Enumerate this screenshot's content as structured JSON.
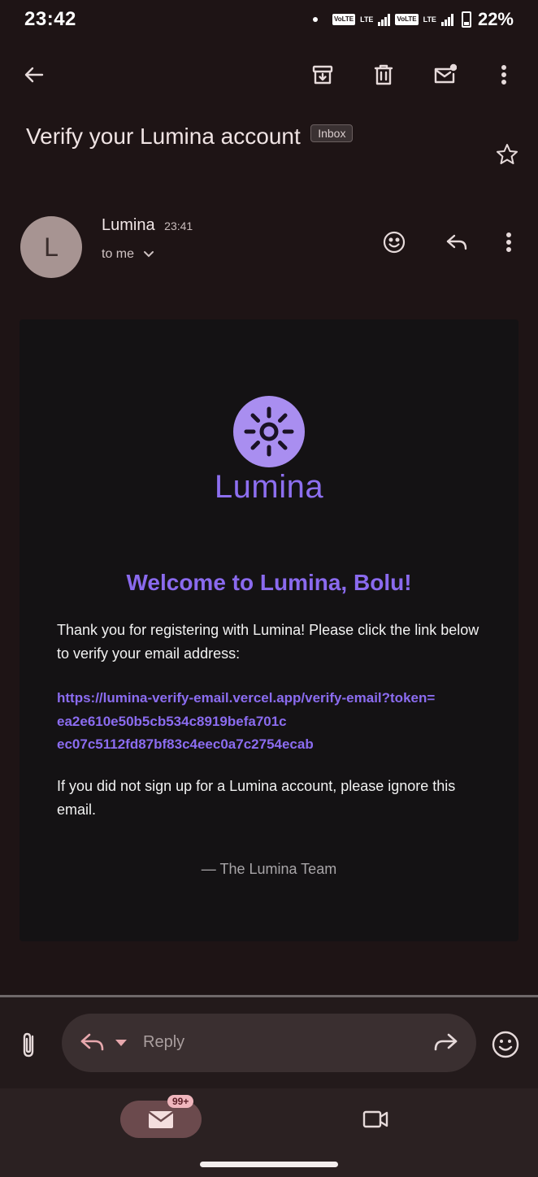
{
  "status_bar": {
    "time": "23:42",
    "sim1_tag": "VoLTE",
    "sim1_network": "LTE",
    "sim2_tag": "VoLTE",
    "sim2_network": "LTE",
    "battery": "22%"
  },
  "toolbar": {
    "back_icon": "arrow-left-icon",
    "archive_icon": "archive-icon",
    "delete_icon": "trash-icon",
    "unread_icon": "mark-unread-icon",
    "more_icon": "more-vertical-icon"
  },
  "email": {
    "subject": "Verify your Lumina account",
    "label": "Inbox",
    "starred": false
  },
  "sender": {
    "initial": "L",
    "name": "Lumina",
    "time": "23:41",
    "recipient": "to me"
  },
  "body": {
    "brand_name": "Lumina",
    "heading": "Welcome to Lumina, Bolu!",
    "intro": "Thank you for registering with Lumina! Please click the link below to verify your email address:",
    "link_line1": "https://lumina-verify-email.vercel.app/verify-email?token=",
    "link_line2": "ea2e610e50b5cb534c8919befa701c",
    "link_line3": "ec07c5112fd87bf83c4eec0a7c2754ecab",
    "ignore_note": "If you did not sign up for a Lumina account, please ignore this email.",
    "signoff": "— The Lumina Team"
  },
  "reply_bar": {
    "placeholder": "Reply"
  },
  "bottom_nav": {
    "mail_badge": "99+"
  },
  "colors": {
    "background": "#1e1415",
    "brand_purple": "#8a6aee",
    "logo_circle": "#a98ef0",
    "card": "#141214"
  }
}
